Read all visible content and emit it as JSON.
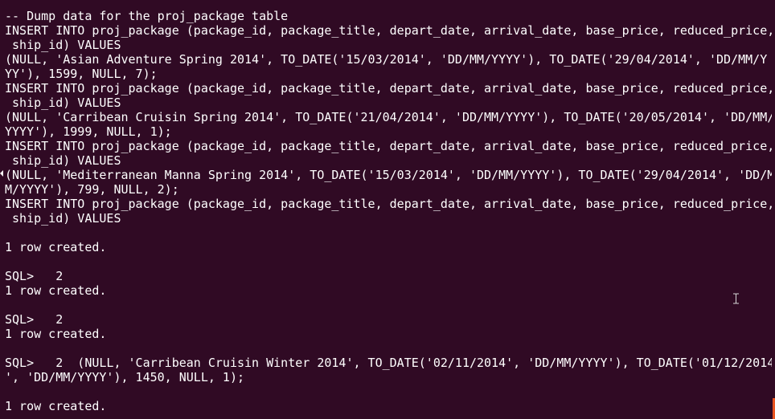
{
  "terminal": {
    "lines": [
      "-- Dump data for the proj_package table",
      "INSERT INTO proj_package (package_id, package_title, depart_date, arrival_date, base_price, reduced_price,",
      " ship_id) VALUES",
      "(NULL, 'Asian Adventure Spring 2014', TO_DATE('15/03/2014', 'DD/MM/YYYY'), TO_DATE('29/04/2014', 'DD/MM/Y",
      "YY'), 1599, NULL, 7);",
      "INSERT INTO proj_package (package_id, package_title, depart_date, arrival_date, base_price, reduced_price,",
      " ship_id) VALUES",
      "(NULL, 'Carribean Cruisin Spring 2014', TO_DATE('21/04/2014', 'DD/MM/YYYY'), TO_DATE('20/05/2014', 'DD/MM/",
      "YYYY'), 1999, NULL, 1);",
      "INSERT INTO proj_package (package_id, package_title, depart_date, arrival_date, base_price, reduced_price,",
      " ship_id) VALUES",
      "(NULL, 'Mediterranean Manna Spring 2014', TO_DATE('15/03/2014', 'DD/MM/YYYY'), TO_DATE('29/04/2014', 'DD/M",
      "M/YYYY'), 799, NULL, 2);",
      "INSERT INTO proj_package (package_id, package_title, depart_date, arrival_date, base_price, reduced_price,",
      " ship_id) VALUES",
      "",
      "1 row created.",
      "",
      "SQL>   2",
      "1 row created.",
      "",
      "SQL>   2",
      "1 row created.",
      "",
      "SQL>   2  (NULL, 'Carribean Cruisin Winter 2014', TO_DATE('02/11/2014', 'DD/MM/YYYY'), TO_DATE('01/12/2014",
      "', 'DD/MM/YYYY'), 1450, NULL, 1);",
      "",
      "1 row created."
    ],
    "colors": {
      "background": "#300a24",
      "foreground": "#ffffff",
      "scroll_indicator": "#e95420"
    },
    "icons": {
      "cursor": "text-cursor-icon",
      "wrap": "wrap-marker-icon"
    }
  }
}
